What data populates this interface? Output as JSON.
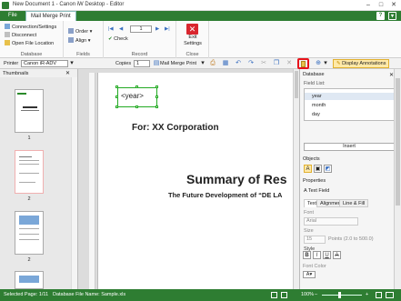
{
  "window": {
    "title": "New Document 1 - Canon iW Desktop - Editor",
    "minimize": "–",
    "maximize": "□",
    "close": "✕"
  },
  "tabs": {
    "file": "File",
    "mail_merge": "Mail Merge Print",
    "help": "?"
  },
  "ribbon": {
    "database": {
      "label": "Database",
      "connection": "Connection/Settings",
      "disconnect": "Disconnect",
      "open_file_location": "Open File Location"
    },
    "fields": {
      "label": "Fields",
      "order": "Order",
      "align": "Align"
    },
    "record": {
      "label": "Record",
      "record_no": "1",
      "check": "Check"
    },
    "close": {
      "label": "Close",
      "exit": "Exit",
      "settings": "Settings"
    }
  },
  "toolbar": {
    "printer_label": "Printer",
    "printer_value": "Canon iR-ADV",
    "copies_label": "Copies",
    "copies_value": "1",
    "print_mode": "Mail Merge Print",
    "display_annotations": "Display Annotations"
  },
  "thumbnails": {
    "title": "Thumbnails",
    "pages": [
      "1",
      "2",
      "2"
    ]
  },
  "document": {
    "field_text": "<year>",
    "for_line": "For: XX Corporation",
    "summary_line": "Summary of Res",
    "future_line": "The Future Development of “DE LA"
  },
  "panel": {
    "database_title": "Database",
    "field_list_label": "Field List:",
    "fields": [
      "year",
      "month",
      "day"
    ],
    "insert": "Insert",
    "objects_title": "Objects",
    "properties_title": "Properties",
    "text_field": "Text Field",
    "tabs": [
      "Text",
      "Alignment",
      "Line & Fill"
    ],
    "font_label": "Font",
    "font_value": "Arial",
    "size_label": "Size",
    "size_value": "15",
    "size_hint": "Points (2.0 to 500.0)",
    "style_label": "Style",
    "style_bold": "B",
    "style_italic": "I",
    "style_underline": "U",
    "style_strike": "A",
    "font_color_label": "Font Color"
  },
  "status": {
    "selected_page": "Selected Page: 1/11",
    "database_file": "Database File Name: Sample.xls",
    "zoom": "100%",
    "zoom_minus": "–",
    "zoom_plus": "+"
  },
  "colors": {
    "brand_green": "#2e7d32",
    "highlight_red": "#e8131b",
    "annotation_yellow": "#ffe9a8"
  }
}
